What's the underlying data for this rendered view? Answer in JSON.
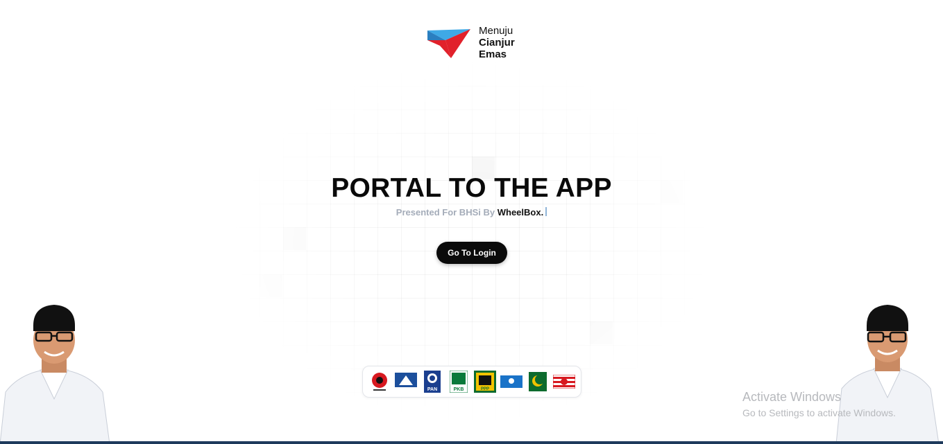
{
  "logo": {
    "line1": "Menuju",
    "line2": "Cianjur",
    "line3": "Emas",
    "colors": {
      "blue": "#3fa9e6",
      "red": "#e1212b"
    }
  },
  "hero": {
    "title": "PORTAL TO THE APP",
    "subtitle_prefix": "Presented For BHSi By",
    "subtitle_brand": "WheelBox."
  },
  "login_button": {
    "label": "Go To Login"
  },
  "party_logos": [
    {
      "name": "pdi-perjuangan-logo",
      "color": "#d71920"
    },
    {
      "name": "demokrat-logo",
      "color": "#1c4f9c"
    },
    {
      "name": "pan-logo",
      "label": "PAN",
      "color": "#1b3f8f"
    },
    {
      "name": "pkb-logo",
      "label": "PKB",
      "color": "#0a7a3b"
    },
    {
      "name": "ppp-logo",
      "label": "PPP",
      "color": "#0d6b2e"
    },
    {
      "name": "perindo-logo",
      "color": "#1a73c8"
    },
    {
      "name": "pbb-logo",
      "color": "#0d6b2e"
    },
    {
      "name": "pkp-logo",
      "color": "#d71920"
    }
  ],
  "watermark": {
    "line1": "Activate Windows",
    "line2": "Go to Settings to activate Windows."
  },
  "colors": {
    "accent": "#0b0b0b",
    "subtitle_gray": "#a4acb9",
    "bottom_bar": "#1e3a5c"
  }
}
